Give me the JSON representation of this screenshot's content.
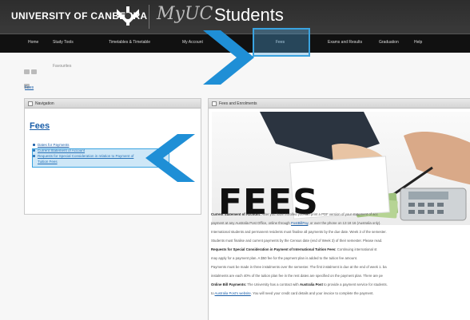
{
  "header": {
    "university": "UNIVERSITY OF CANBERRA",
    "portal_script": "MyUC",
    "portal_title": "Students"
  },
  "nav": {
    "items": [
      {
        "label": "Home"
      },
      {
        "label": "Study Tools"
      },
      {
        "label": "Timetables & Timetable"
      },
      {
        "label": "My Account"
      },
      {
        "label": "Fees"
      },
      {
        "label": "Exams and Results"
      },
      {
        "label": "Graduation"
      },
      {
        "label": "Help"
      }
    ],
    "active": "Fees"
  },
  "breadcrumb": {
    "text": "Favourites"
  },
  "fees_link": "Fees",
  "navigation_panel": {
    "title": "Navigation",
    "heading": "Fees",
    "links": [
      "Dates for Payments",
      "Current Statement of Account",
      "Requests for Special Consideration in relation to Payment of",
      "Tuition Fees"
    ]
  },
  "fees_panel": {
    "title": "Fees and Enrolments",
    "hero_word": "FEES",
    "paragraphs": [
      {
        "bold": "Current Statement of Account:",
        "text": " After you have enrolled you can print a PDF version of your statement of acc"
      },
      {
        "bold": "",
        "text": "payment at any Australia Post Office, online through ",
        "link": "PostBillPay",
        "tail": ", or over the phone on 13 18 16 (Australia only)."
      },
      {
        "bold": "",
        "text": "International students and permanent residents must finalise all payments by the due date. Week 3 of the semester."
      },
      {
        "bold": "",
        "text": "Students must finalise and current payments by the Census date (end of Week 3) of their semester. Please read."
      },
      {
        "bold": "Requests for Special Consideration in Payment of International Tuition Fees:",
        "text": " Continuing international st"
      },
      {
        "bold": "",
        "text": "may apply for a payment plan. A $50 fee for the payment plan is added to the tuition fee amount."
      },
      {
        "bold": "",
        "text": "Payments must be made in three instalments over the semester. The first instalment is due at the end of week 1. ba"
      },
      {
        "bold": "",
        "text": "instalments are each 40% of the tuition plan fee in the rest dates are specified on the payment plan. There are pe"
      },
      {
        "bold": "Online Bill Payments:",
        "text": " The University has a contract with ",
        "link2": "Australia Post",
        "tail": " to provide a payment service for students."
      },
      {
        "bold": "",
        "text": "to ",
        "link": "Australia Post's website",
        "tail": ". You will need your credit card details and your invoice to complete the payment."
      }
    ]
  },
  "colors": {
    "header_bg": "#2d2d2d",
    "nav_bg": "#111111",
    "link": "#1a5ea8",
    "highlight": "#3aa3e0",
    "arrow": "#1f8fd6"
  }
}
